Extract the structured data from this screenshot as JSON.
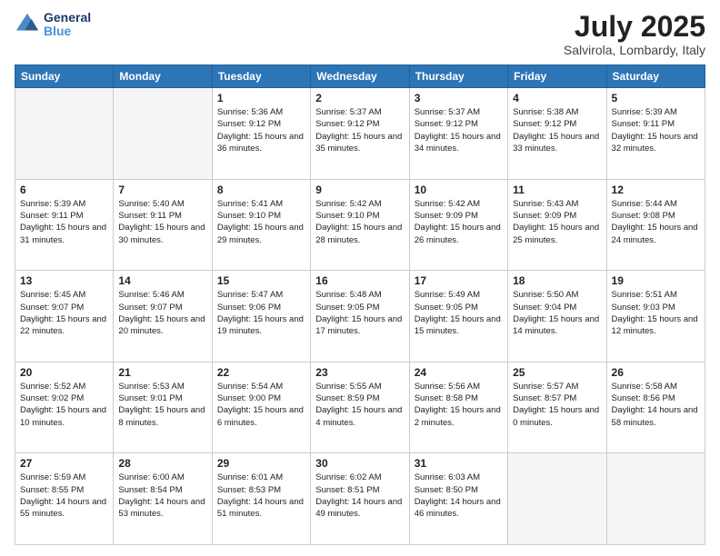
{
  "header": {
    "logo_line1": "General",
    "logo_line2": "Blue",
    "month": "July 2025",
    "location": "Salvirola, Lombardy, Italy"
  },
  "weekdays": [
    "Sunday",
    "Monday",
    "Tuesday",
    "Wednesday",
    "Thursday",
    "Friday",
    "Saturday"
  ],
  "weeks": [
    [
      {
        "day": "",
        "empty": true
      },
      {
        "day": "",
        "empty": true
      },
      {
        "day": "1",
        "sunrise": "5:36 AM",
        "sunset": "9:12 PM",
        "daylight": "15 hours and 36 minutes."
      },
      {
        "day": "2",
        "sunrise": "5:37 AM",
        "sunset": "9:12 PM",
        "daylight": "15 hours and 35 minutes."
      },
      {
        "day": "3",
        "sunrise": "5:37 AM",
        "sunset": "9:12 PM",
        "daylight": "15 hours and 34 minutes."
      },
      {
        "day": "4",
        "sunrise": "5:38 AM",
        "sunset": "9:12 PM",
        "daylight": "15 hours and 33 minutes."
      },
      {
        "day": "5",
        "sunrise": "5:39 AM",
        "sunset": "9:11 PM",
        "daylight": "15 hours and 32 minutes."
      }
    ],
    [
      {
        "day": "6",
        "sunrise": "5:39 AM",
        "sunset": "9:11 PM",
        "daylight": "15 hours and 31 minutes."
      },
      {
        "day": "7",
        "sunrise": "5:40 AM",
        "sunset": "9:11 PM",
        "daylight": "15 hours and 30 minutes."
      },
      {
        "day": "8",
        "sunrise": "5:41 AM",
        "sunset": "9:10 PM",
        "daylight": "15 hours and 29 minutes."
      },
      {
        "day": "9",
        "sunrise": "5:42 AM",
        "sunset": "9:10 PM",
        "daylight": "15 hours and 28 minutes."
      },
      {
        "day": "10",
        "sunrise": "5:42 AM",
        "sunset": "9:09 PM",
        "daylight": "15 hours and 26 minutes."
      },
      {
        "day": "11",
        "sunrise": "5:43 AM",
        "sunset": "9:09 PM",
        "daylight": "15 hours and 25 minutes."
      },
      {
        "day": "12",
        "sunrise": "5:44 AM",
        "sunset": "9:08 PM",
        "daylight": "15 hours and 24 minutes."
      }
    ],
    [
      {
        "day": "13",
        "sunrise": "5:45 AM",
        "sunset": "9:07 PM",
        "daylight": "15 hours and 22 minutes."
      },
      {
        "day": "14",
        "sunrise": "5:46 AM",
        "sunset": "9:07 PM",
        "daylight": "15 hours and 20 minutes."
      },
      {
        "day": "15",
        "sunrise": "5:47 AM",
        "sunset": "9:06 PM",
        "daylight": "15 hours and 19 minutes."
      },
      {
        "day": "16",
        "sunrise": "5:48 AM",
        "sunset": "9:05 PM",
        "daylight": "15 hours and 17 minutes."
      },
      {
        "day": "17",
        "sunrise": "5:49 AM",
        "sunset": "9:05 PM",
        "daylight": "15 hours and 15 minutes."
      },
      {
        "day": "18",
        "sunrise": "5:50 AM",
        "sunset": "9:04 PM",
        "daylight": "15 hours and 14 minutes."
      },
      {
        "day": "19",
        "sunrise": "5:51 AM",
        "sunset": "9:03 PM",
        "daylight": "15 hours and 12 minutes."
      }
    ],
    [
      {
        "day": "20",
        "sunrise": "5:52 AM",
        "sunset": "9:02 PM",
        "daylight": "15 hours and 10 minutes."
      },
      {
        "day": "21",
        "sunrise": "5:53 AM",
        "sunset": "9:01 PM",
        "daylight": "15 hours and 8 minutes."
      },
      {
        "day": "22",
        "sunrise": "5:54 AM",
        "sunset": "9:00 PM",
        "daylight": "15 hours and 6 minutes."
      },
      {
        "day": "23",
        "sunrise": "5:55 AM",
        "sunset": "8:59 PM",
        "daylight": "15 hours and 4 minutes."
      },
      {
        "day": "24",
        "sunrise": "5:56 AM",
        "sunset": "8:58 PM",
        "daylight": "15 hours and 2 minutes."
      },
      {
        "day": "25",
        "sunrise": "5:57 AM",
        "sunset": "8:57 PM",
        "daylight": "15 hours and 0 minutes."
      },
      {
        "day": "26",
        "sunrise": "5:58 AM",
        "sunset": "8:56 PM",
        "daylight": "14 hours and 58 minutes."
      }
    ],
    [
      {
        "day": "27",
        "sunrise": "5:59 AM",
        "sunset": "8:55 PM",
        "daylight": "14 hours and 55 minutes."
      },
      {
        "day": "28",
        "sunrise": "6:00 AM",
        "sunset": "8:54 PM",
        "daylight": "14 hours and 53 minutes."
      },
      {
        "day": "29",
        "sunrise": "6:01 AM",
        "sunset": "8:53 PM",
        "daylight": "14 hours and 51 minutes."
      },
      {
        "day": "30",
        "sunrise": "6:02 AM",
        "sunset": "8:51 PM",
        "daylight": "14 hours and 49 minutes."
      },
      {
        "day": "31",
        "sunrise": "6:03 AM",
        "sunset": "8:50 PM",
        "daylight": "14 hours and 46 minutes."
      },
      {
        "day": "",
        "empty": true
      },
      {
        "day": "",
        "empty": true
      }
    ]
  ]
}
